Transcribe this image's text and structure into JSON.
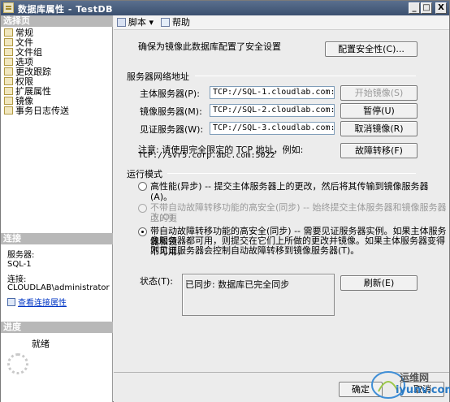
{
  "window": {
    "title": "数据库属性 - TestDB",
    "min_glyph": "_",
    "max_glyph": "□",
    "close_glyph": "X"
  },
  "left": {
    "select_page_header": "选择页",
    "pages": [
      {
        "label": "常规",
        "icon": "page-icon"
      },
      {
        "label": "文件",
        "icon": "page-icon"
      },
      {
        "label": "文件组",
        "icon": "page-icon"
      },
      {
        "label": "选项",
        "icon": "page-icon"
      },
      {
        "label": "更改跟踪",
        "icon": "page-icon"
      },
      {
        "label": "权限",
        "icon": "page-icon"
      },
      {
        "label": "扩展属性",
        "icon": "page-icon"
      },
      {
        "label": "镜像",
        "icon": "page-icon",
        "selected": true
      },
      {
        "label": "事务日志传送",
        "icon": "page-icon"
      }
    ],
    "connection_header": "连接",
    "server_label": "服务器:",
    "server_value": "SQL-1",
    "connection_label": "连接:",
    "connection_value": "CLOUDLAB\\administrator",
    "view_connection_link": "查看连接属性",
    "progress_header": "进度",
    "progress_status": "就绪"
  },
  "toolbar": {
    "script_label": "脚本",
    "help_label": "帮助"
  },
  "main": {
    "security_note": "确保为镜像此数据库配置了安全设置",
    "configure_security_button": "配置安全性(C)...",
    "network_group_title": "服务器网络地址",
    "principal_label": "主体服务器(P):",
    "principal_value": "TCP://SQL-1.cloudlab.com:5022",
    "mirror_label": "镜像服务器(M):",
    "mirror_value": "TCP://SQL-2.cloudlab.com:5022",
    "witness_label": "见证服务器(W):",
    "witness_value": "TCP://SQL-3.cloudlab.com:5022",
    "start_mirroring_button": "开始镜像(S)",
    "pause_button": "暂停(U)",
    "remove_mirroring_button": "取消镜像(R)",
    "failover_button": "故障转移(F)",
    "note_line1": "注意: 请使用完全限定的 TCP 地址，例如:",
    "note_line2": "TCP://svr5.corp.abc.com:5022",
    "mode_group_title": "运行模式",
    "mode_high_performance": "高性能(异步) -- 提交主体服务器上的更改，然后将其传输到镜像服务器(A)。",
    "mode_high_safety_no_failover_1": "不带自动故障转移功能的高安全(同步) -- 始终提交主体服务器和镜像服务器上的更",
    "mode_high_safety_no_failover_2": "改(O)。",
    "mode_high_safety_failover_1": "带自动故障转移功能的高安全(同步) -- 需要见证服务器实例。如果主体服务器和镜",
    "mode_high_safety_failover_2": "像服务器都可用，则提交在它们上所做的更改并镜像。如果主体服务器变得不可用，",
    "mode_high_safety_failover_3": "则见证服务器会控制自动故障转移到镜像服务器(T)。",
    "status_label": "状态(T):",
    "status_value": "已同步: 数据库已完全同步",
    "refresh_button": "刷新(E)",
    "ok_button": "确定",
    "cancel_button": "取消"
  },
  "watermark": {
    "line1": "运维网",
    "line2": "iyunv.com"
  }
}
